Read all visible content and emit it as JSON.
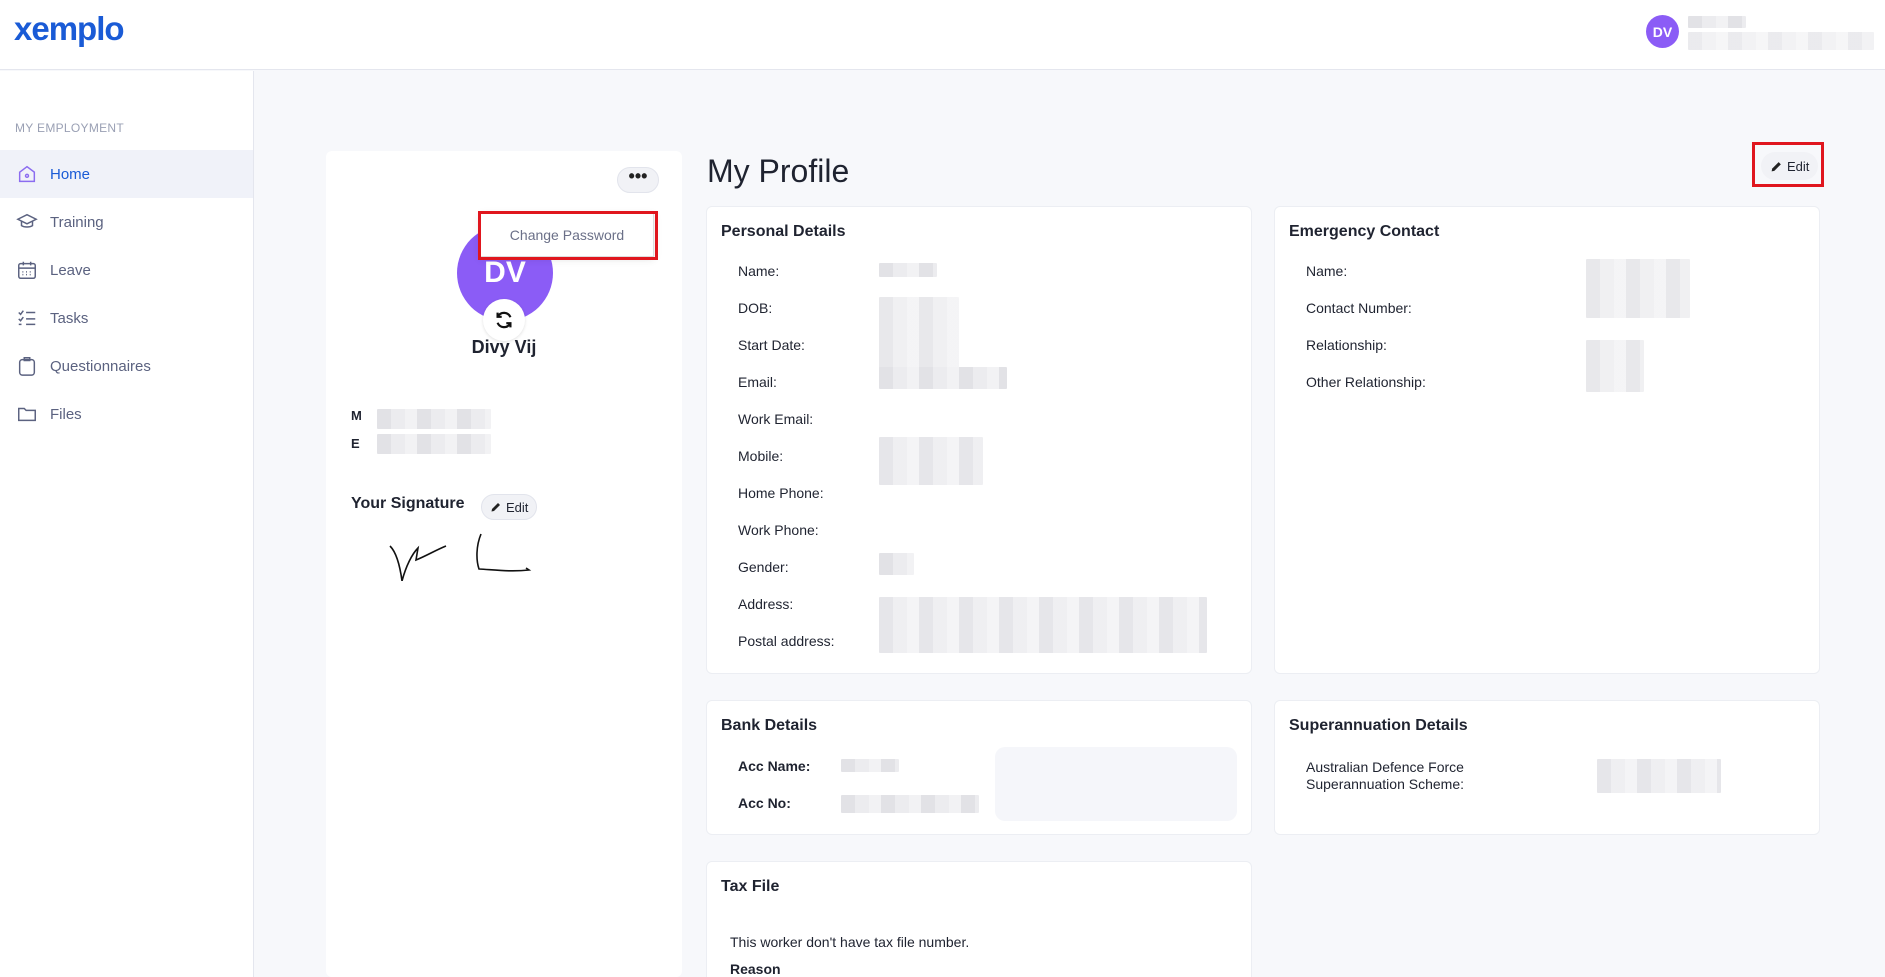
{
  "header": {
    "logo": "xemplo",
    "user_initials": "DV"
  },
  "sidebar": {
    "section_label": "MY EMPLOYMENT",
    "items": [
      {
        "label": "Home",
        "icon": "home-icon",
        "active": true
      },
      {
        "label": "Training",
        "icon": "graduation-cap-icon"
      },
      {
        "label": "Leave",
        "icon": "calendar-icon"
      },
      {
        "label": "Tasks",
        "icon": "checklist-icon"
      },
      {
        "label": "Questionnaires",
        "icon": "clipboard-icon"
      },
      {
        "label": "Files",
        "icon": "folder-icon"
      }
    ]
  },
  "profile": {
    "more_label": "•••",
    "menu_item": "Change Password",
    "initials": "DV",
    "name": "Divy Vij",
    "mobile_label": "M",
    "email_label": "E",
    "signature_title": "Your Signature",
    "signature_edit": "Edit"
  },
  "main": {
    "title": "My Profile",
    "edit_label": "Edit",
    "personal": {
      "title": "Personal Details",
      "fields": [
        "Name:",
        "DOB:",
        "Start Date:",
        "Email:",
        "Work Email:",
        "Mobile:",
        "Home Phone:",
        "Work Phone:",
        "Gender:",
        "Address:",
        "Postal address:"
      ]
    },
    "emergency": {
      "title": "Emergency Contact",
      "fields": [
        "Name:",
        "Contact Number:",
        "Relationship:",
        "Other Relationship:"
      ]
    },
    "bank": {
      "title": "Bank Details",
      "fields": [
        "Acc Name:",
        "Acc No:"
      ]
    },
    "super": {
      "title": "Superannuation Details",
      "fund": "Australian Defence Force Superannuation Scheme:"
    },
    "tax": {
      "title": "Tax File",
      "text": "This worker don't have tax file number.",
      "reason_label": "Reason"
    }
  },
  "colors": {
    "brand": "#1a5bd6",
    "avatar": "#8b5cf6",
    "highlight": "#e0161e"
  }
}
